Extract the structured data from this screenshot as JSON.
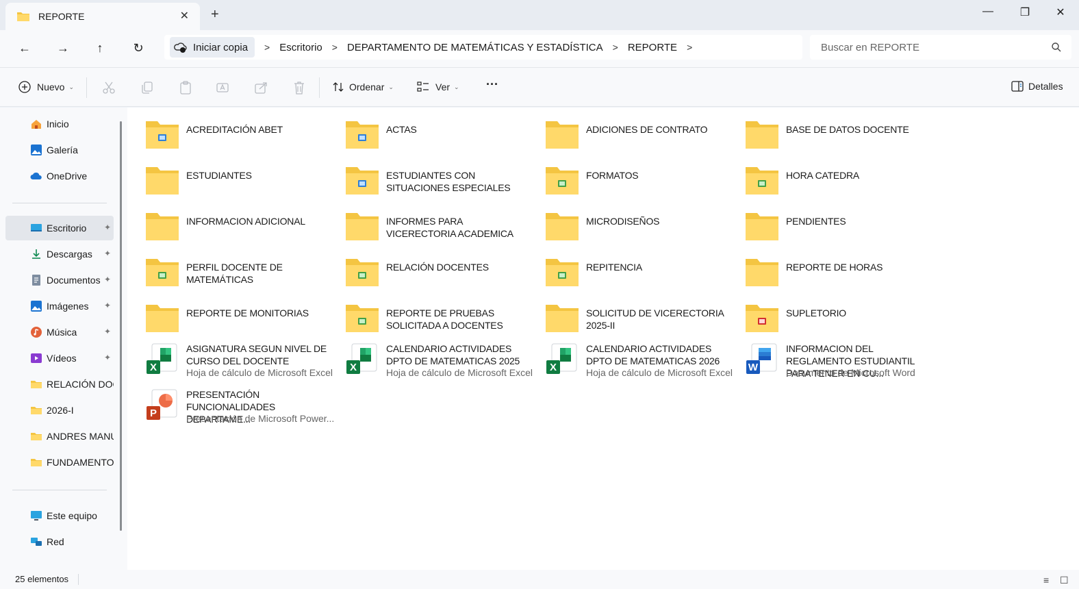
{
  "window": {
    "tab_title": "REPORTE",
    "tab_close": "✕",
    "new_tab": "+",
    "minimize": "—",
    "maximize": "❐",
    "close": "✕"
  },
  "navigation": {
    "back": "←",
    "forward": "→",
    "up": "↑",
    "refresh": "↻"
  },
  "breadcrumb": {
    "home_label": "Iniciar copia",
    "items": [
      "Escritorio",
      "DEPARTAMENTO DE MATEMÁTICAS Y ESTADÍSTICA",
      "REPORTE"
    ],
    "separator": ">"
  },
  "search": {
    "placeholder": "Buscar en REPORTE"
  },
  "commandbar": {
    "new_label": "Nuevo",
    "sort_label": "Ordenar",
    "view_label": "Ver",
    "more_label": "···",
    "details_label": "Detalles"
  },
  "sidebar": {
    "items": [
      {
        "label": "Inicio",
        "icon": "home-icon"
      },
      {
        "label": "Galería",
        "icon": "gallery-icon"
      },
      {
        "label": "OneDrive",
        "icon": "cloud-icon"
      },
      {
        "label": "Escritorio",
        "icon": "desktop-icon"
      },
      {
        "label": "Descargas",
        "icon": "download-icon"
      },
      {
        "label": "Documentos",
        "icon": "documents-icon"
      },
      {
        "label": "Imágenes",
        "icon": "pictures-icon"
      },
      {
        "label": "Música",
        "icon": "music-icon"
      },
      {
        "label": "Vídeos",
        "icon": "videos-icon"
      },
      {
        "label": "RELACIÓN DOC",
        "icon": "folder-icon"
      },
      {
        "label": "2026-I",
        "icon": "folder-icon"
      },
      {
        "label": "ANDRES MANU",
        "icon": "folder-icon"
      },
      {
        "label": "FUNDAMENTOS",
        "icon": "folder-icon"
      },
      {
        "label": "Este equipo",
        "icon": "computer-icon"
      },
      {
        "label": "Red",
        "icon": "network-icon"
      }
    ],
    "pin_glyph": "📌"
  },
  "items": [
    {
      "name": "ACREDITACIÓN ABET",
      "kind": "folder",
      "badge": "doc"
    },
    {
      "name": "ACTAS",
      "kind": "folder",
      "badge": "doc"
    },
    {
      "name": "ADICIONES DE CONTRATO",
      "kind": "folder",
      "badge": ""
    },
    {
      "name": "BASE DE DATOS DOCENTE",
      "kind": "folder",
      "badge": ""
    },
    {
      "name": "ESTUDIANTES",
      "kind": "folder",
      "badge": ""
    },
    {
      "name": "ESTUDIANTES CON SITUACIONES ESPECIALES",
      "kind": "folder",
      "badge": "doc"
    },
    {
      "name": "FORMATOS",
      "kind": "folder",
      "badge": "xls"
    },
    {
      "name": "HORA CATEDRA",
      "kind": "folder",
      "badge": "xls"
    },
    {
      "name": "INFORMACION ADICIONAL",
      "kind": "folder",
      "badge": ""
    },
    {
      "name": "INFORMES PARA VICERECTORIA ACADEMICA",
      "kind": "folder",
      "badge": ""
    },
    {
      "name": "MICRODISEÑOS",
      "kind": "folder",
      "badge": ""
    },
    {
      "name": "PENDIENTES",
      "kind": "folder",
      "badge": ""
    },
    {
      "name": "PERFIL DOCENTE DE MATEMÁTICAS",
      "kind": "folder",
      "badge": "xls"
    },
    {
      "name": "RELACIÓN DOCENTES",
      "kind": "folder",
      "badge": "xls"
    },
    {
      "name": "REPITENCIA",
      "kind": "folder",
      "badge": "xls"
    },
    {
      "name": "REPORTE DE HORAS",
      "kind": "folder",
      "badge": ""
    },
    {
      "name": "REPORTE DE MONITORIAS",
      "kind": "folder",
      "badge": ""
    },
    {
      "name": "REPORTE DE PRUEBAS SOLICITADA A DOCENTES",
      "kind": "folder",
      "badge": "xls"
    },
    {
      "name": "SOLICITUD DE VICERECTORIA 2025-II",
      "kind": "folder",
      "badge": ""
    },
    {
      "name": "SUPLETORIO",
      "kind": "folder",
      "badge": "pdf"
    },
    {
      "name": "ASIGNATURA SEGUN NIVEL DE CURSO DEL DOCENTE",
      "kind": "excel",
      "type": "Hoja de cálculo de Microsoft Excel"
    },
    {
      "name": "CALENDARIO ACTIVIDADES DPTO DE MATEMATICAS 2025",
      "kind": "excel",
      "type": "Hoja de cálculo de Microsoft Excel"
    },
    {
      "name": "CALENDARIO ACTIVIDADES DPTO DE MATEMATICAS 2026",
      "kind": "excel",
      "type": "Hoja de cálculo de Microsoft Excel"
    },
    {
      "name": "INFORMACION DEL REGLAMENTO ESTUDIANTIL PARA TENER EN CU...",
      "kind": "word",
      "type": "Documento de Microsoft Word"
    },
    {
      "name": "PRESENTACIÓN FUNCIONALIDADES DEPARTAME...",
      "kind": "powerpoint",
      "type": "Presentación de Microsoft Power..."
    }
  ],
  "statusbar": {
    "count": "25 elementos"
  },
  "colors": {
    "folder": "#f4c542",
    "folder_light": "#ffd96a",
    "accent": "#0067c0",
    "excel": "#107c41",
    "word": "#185abd",
    "powerpoint": "#c43e1c"
  }
}
